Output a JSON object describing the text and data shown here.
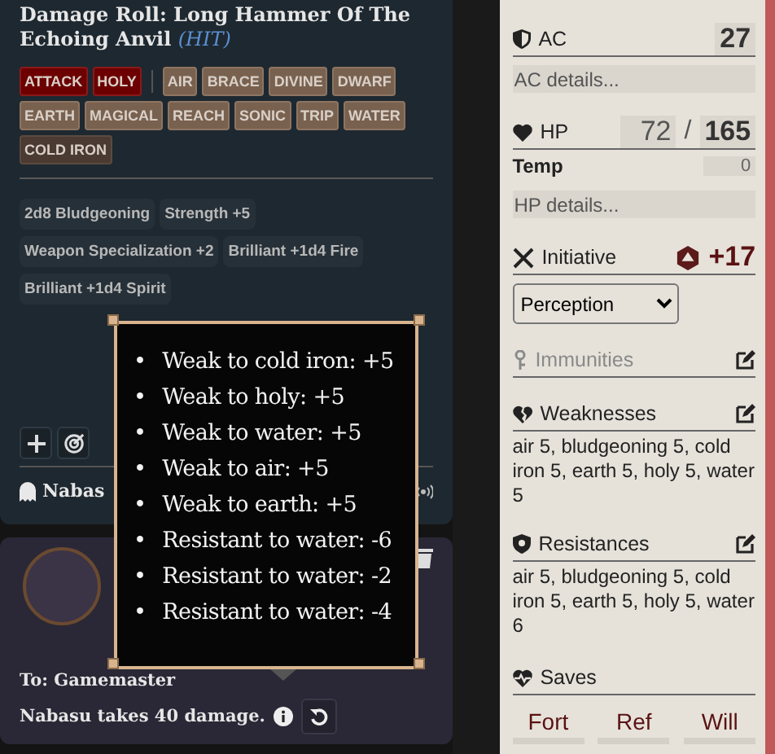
{
  "roll_card": {
    "title": "Damage Roll: Long Hammer Of The Echoing Anvil",
    "outcome": "(HIT)",
    "tags": [
      {
        "label": "ATTACK",
        "kind": "action"
      },
      {
        "label": "HOLY",
        "kind": "action"
      },
      {
        "label": "AIR",
        "kind": "trait"
      },
      {
        "label": "BRACE",
        "kind": "trait"
      },
      {
        "label": "DIVINE",
        "kind": "trait"
      },
      {
        "label": "DWARF",
        "kind": "trait"
      },
      {
        "label": "EARTH",
        "kind": "trait"
      },
      {
        "label": "MAGICAL",
        "kind": "trait"
      },
      {
        "label": "REACH",
        "kind": "trait"
      },
      {
        "label": "SONIC",
        "kind": "trait"
      },
      {
        "label": "TRIP",
        "kind": "trait"
      },
      {
        "label": "WATER",
        "kind": "trait"
      },
      {
        "label": "COLD IRON",
        "kind": "material"
      }
    ],
    "modifiers": [
      "2d8 Bludgeoning",
      "Strength +5",
      "Weapon Specialization +2",
      "Brilliant +1d4 Fire",
      "Brilliant +1d4 Spirit"
    ],
    "target": "Nabas"
  },
  "message_card": {
    "recipient": "To: Gamemaster",
    "text": "Nabasu takes 40 damage."
  },
  "tooltip": {
    "marker": "•",
    "items": [
      "Weak to cold iron: +5",
      "Weak to holy: +5",
      "Weak to water: +5",
      "Weak to air: +5",
      "Weak to earth: +5",
      "Resistant to water: -6",
      "Resistant to water: -2",
      "Resistant to water: -4"
    ]
  },
  "sheet": {
    "ac": {
      "label": "AC",
      "value": "27",
      "placeholder": "AC details..."
    },
    "hp": {
      "label": "HP",
      "value": "72",
      "separator": "/",
      "max": "165",
      "temp_label": "Temp",
      "temp": "0",
      "placeholder": "HP details..."
    },
    "initiative": {
      "label": "Initiative",
      "value": "+17",
      "skill": "Perception"
    },
    "sections": [
      {
        "title": "Immunities",
        "kind": "immunities",
        "disabled": true
      },
      {
        "title": "Weaknesses",
        "kind": "weaknesses",
        "disabled": false,
        "text": "air 5, bludgeoning 5, cold iron 5, earth 5, holy 5, water 5"
      },
      {
        "title": "Resistances",
        "kind": "resistances",
        "disabled": false,
        "text": "air 5, bludgeoning 5, cold iron 5, earth 5, holy 5, water 6"
      }
    ],
    "saves": {
      "title": "Saves",
      "items": [
        "Fort",
        "Ref",
        "Will"
      ]
    }
  }
}
